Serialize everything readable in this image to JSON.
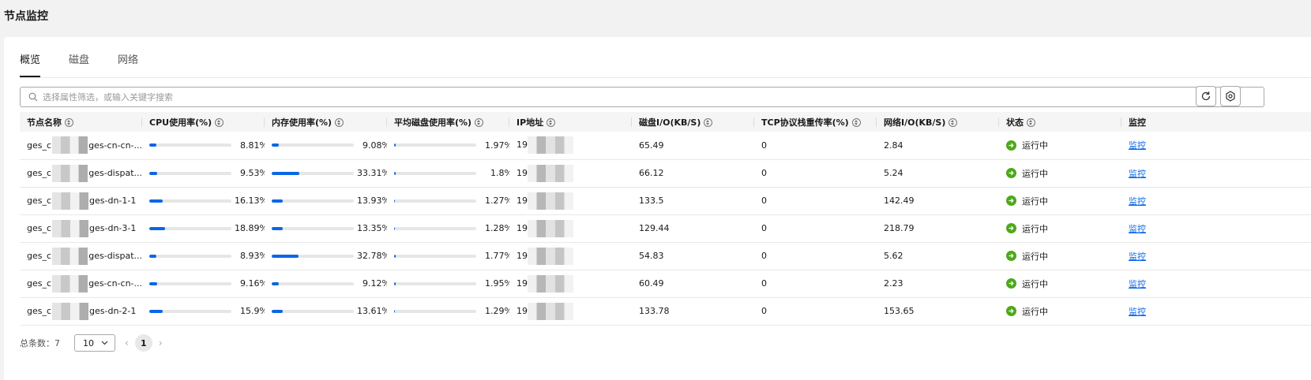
{
  "page": {
    "title": "节点监控"
  },
  "tabs": [
    {
      "label": "概览",
      "active": true
    },
    {
      "label": "磁盘",
      "active": false
    },
    {
      "label": "网络",
      "active": false
    }
  ],
  "search": {
    "placeholder": "选择属性筛选，或输入关键字搜索",
    "value": ""
  },
  "toolbar": {
    "refresh_icon": "refresh-icon",
    "settings_icon": "gear-icon"
  },
  "table": {
    "headers": [
      "节点名称",
      "CPU使用率(%)",
      "内存使用率(%)",
      "平均磁盘使用率(%)",
      "IP地址",
      "磁盘I/O(KB/S)",
      "TCP协议栈重传率(%)",
      "网络I/O(KB/S)",
      "状态",
      "监控"
    ],
    "rows": [
      {
        "name_prefix": "ges_c",
        "name_suffix": "ges-cn-cn-...",
        "cpu": "8.81%",
        "cpu_pct": 8.81,
        "mem": "9.08%",
        "mem_pct": 9.08,
        "disk": "1.97%",
        "disk_pct": 1.97,
        "ip": "19",
        "disk_io": "65.49",
        "tcp": "0",
        "net_io": "2.84",
        "status": "运行中",
        "action": "监控"
      },
      {
        "name_prefix": "ges_c",
        "name_suffix": "ges-dispat...",
        "cpu": "9.53%",
        "cpu_pct": 9.53,
        "mem": "33.31%",
        "mem_pct": 33.31,
        "disk": "1.8%",
        "disk_pct": 1.8,
        "ip": "19",
        "disk_io": "66.12",
        "tcp": "0",
        "net_io": "5.24",
        "status": "运行中",
        "action": "监控"
      },
      {
        "name_prefix": "ges_c",
        "name_suffix": "ges-dn-1-1",
        "cpu": "16.13%",
        "cpu_pct": 16.13,
        "mem": "13.93%",
        "mem_pct": 13.93,
        "disk": "1.27%",
        "disk_pct": 1.27,
        "ip": "19",
        "disk_io": "133.5",
        "tcp": "0",
        "net_io": "142.49",
        "status": "运行中",
        "action": "监控"
      },
      {
        "name_prefix": "ges_c",
        "name_suffix": "ges-dn-3-1",
        "cpu": "18.89%",
        "cpu_pct": 18.89,
        "mem": "13.35%",
        "mem_pct": 13.35,
        "disk": "1.28%",
        "disk_pct": 1.28,
        "ip": "19",
        "disk_io": "129.44",
        "tcp": "0",
        "net_io": "218.79",
        "status": "运行中",
        "action": "监控"
      },
      {
        "name_prefix": "ges_c",
        "name_suffix": "ges-dispat...",
        "cpu": "8.93%",
        "cpu_pct": 8.93,
        "mem": "32.78%",
        "mem_pct": 32.78,
        "disk": "1.77%",
        "disk_pct": 1.77,
        "ip": "19",
        "disk_io": "54.83",
        "tcp": "0",
        "net_io": "5.62",
        "status": "运行中",
        "action": "监控"
      },
      {
        "name_prefix": "ges_c",
        "name_suffix": "ges-cn-cn-...",
        "cpu": "9.16%",
        "cpu_pct": 9.16,
        "mem": "9.12%",
        "mem_pct": 9.12,
        "disk": "1.95%",
        "disk_pct": 1.95,
        "ip": "19",
        "disk_io": "60.49",
        "tcp": "0",
        "net_io": "2.23",
        "status": "运行中",
        "action": "监控"
      },
      {
        "name_prefix": "ges_c",
        "name_suffix": "ges-dn-2-1",
        "cpu": "15.9%",
        "cpu_pct": 15.9,
        "mem": "13.61%",
        "mem_pct": 13.61,
        "disk": "1.29%",
        "disk_pct": 1.29,
        "ip": "19",
        "disk_io": "133.78",
        "tcp": "0",
        "net_io": "153.65",
        "status": "运行中",
        "action": "监控"
      }
    ]
  },
  "pagination": {
    "total_label": "总条数：",
    "total": "7",
    "page_size": "10",
    "current_page": "1"
  },
  "colors": {
    "accent": "#0a66e6",
    "status_running": "#4ea81b"
  }
}
